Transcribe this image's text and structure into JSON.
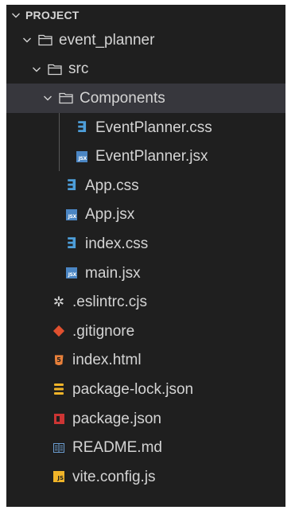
{
  "explorer": {
    "section_title": "PROJECT",
    "items": [
      {
        "label": "event_planner",
        "kind": "folder",
        "expanded": true
      },
      {
        "label": "src",
        "kind": "folder",
        "expanded": true
      },
      {
        "label": "Components",
        "kind": "folder",
        "expanded": true,
        "selected": true
      },
      {
        "label": "EventPlanner.css",
        "kind": "file",
        "icon": "css-icon"
      },
      {
        "label": "EventPlanner.jsx",
        "kind": "file",
        "icon": "jsx-icon"
      },
      {
        "label": "App.css",
        "kind": "file",
        "icon": "css-icon"
      },
      {
        "label": "App.jsx",
        "kind": "file",
        "icon": "jsx-icon"
      },
      {
        "label": "index.css",
        "kind": "file",
        "icon": "css-icon"
      },
      {
        "label": "main.jsx",
        "kind": "file",
        "icon": "jsx-icon"
      },
      {
        "label": ".eslintrc.cjs",
        "kind": "file",
        "icon": "gear-icon"
      },
      {
        "label": ".gitignore",
        "kind": "file",
        "icon": "git-icon"
      },
      {
        "label": "index.html",
        "kind": "file",
        "icon": "html5-icon"
      },
      {
        "label": "package-lock.json",
        "kind": "file",
        "icon": "lock-json-icon"
      },
      {
        "label": "package.json",
        "kind": "file",
        "icon": "npm-icon"
      },
      {
        "label": "README.md",
        "kind": "file",
        "icon": "markdown-icon"
      },
      {
        "label": "vite.config.js",
        "kind": "file",
        "icon": "js-icon"
      }
    ]
  },
  "icon_text": {
    "jsx": "JSX",
    "js": "JS",
    "html5": "5"
  },
  "colors": {
    "background": "#1f1f1f",
    "selected_row": "#37373d",
    "text": "#d4d4d4",
    "css_blue": "#4d9ed9",
    "jsx_blue": "#4b86c4",
    "git_red": "#e0502f",
    "html_orange": "#e8803a",
    "lock_yellow": "#f0b429",
    "npm_red": "#cc3534",
    "js_yellow": "#f0b429"
  }
}
